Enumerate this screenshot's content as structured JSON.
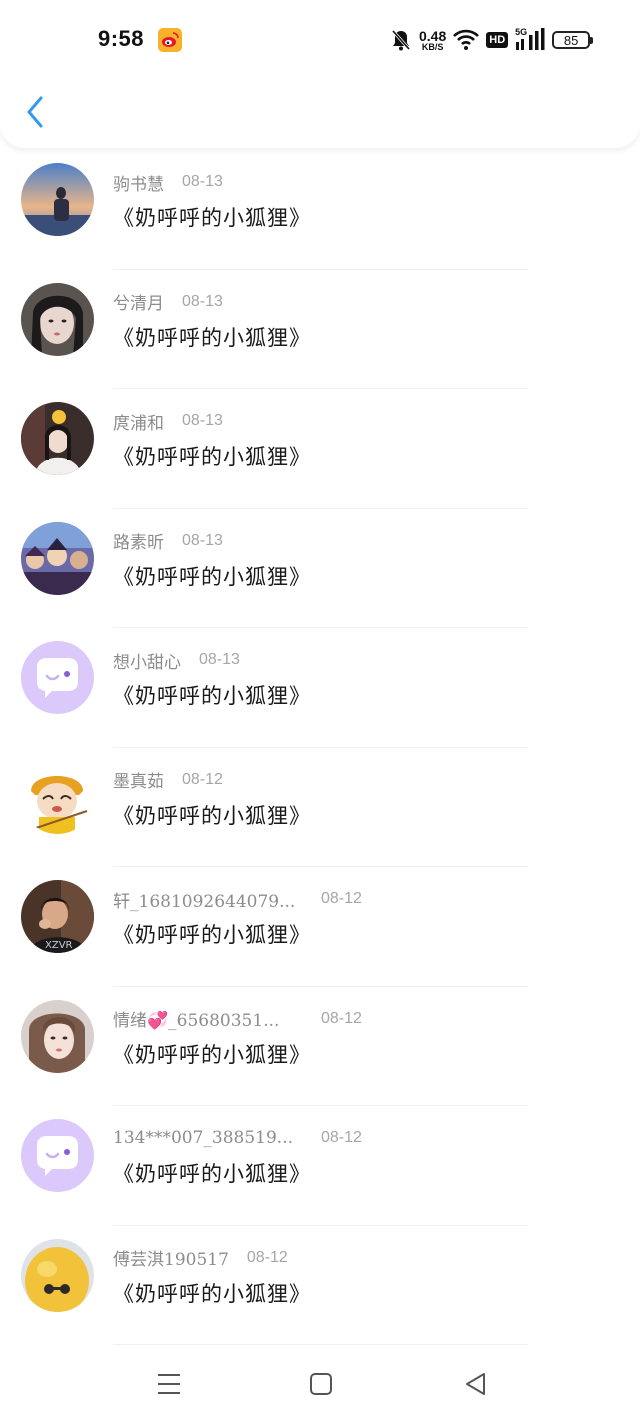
{
  "status_bar": {
    "time": "9:58",
    "net_speed": "0.48",
    "net_unit": "KB/S",
    "hd_label": "HD",
    "signal_label": "5G",
    "battery": "85"
  },
  "header": {
    "back_icon": "chevron-left-icon",
    "accent_color": "#2f9bea"
  },
  "list": [
    {
      "name": "驹书慧",
      "date": "08-13",
      "message": "《奶呼呼的小狐狸》",
      "avatar": "photo"
    },
    {
      "name": "兮清月",
      "date": "08-13",
      "message": "《奶呼呼的小狐狸》",
      "avatar": "photo"
    },
    {
      "name": "庹浦和",
      "date": "08-13",
      "message": "《奶呼呼的小狐狸》",
      "avatar": "photo"
    },
    {
      "name": "路素昕",
      "date": "08-13",
      "message": "《奶呼呼的小狐狸》",
      "avatar": "photo"
    },
    {
      "name": "想小甜心",
      "date": "08-13",
      "message": "《奶呼呼的小狐狸》",
      "avatar": "default-chat-icon"
    },
    {
      "name": "墨真茹",
      "date": "08-12",
      "message": "《奶呼呼的小狐狸》",
      "avatar": "cartoon"
    },
    {
      "name": "轩_1681092644079...",
      "date": "08-12",
      "message": "《奶呼呼的小狐狸》",
      "avatar": "photo"
    },
    {
      "name": "情绪💞_65680351...",
      "date": "08-12",
      "message": "《奶呼呼的小狐狸》",
      "avatar": "photo"
    },
    {
      "name": "134***007_388519...",
      "date": "08-12",
      "message": "《奶呼呼的小狐狸》",
      "avatar": "default-chat-icon"
    },
    {
      "name": "傅芸淇190517",
      "date": "08-12",
      "message": "《奶呼呼的小狐狸》",
      "avatar": "photo"
    }
  ],
  "nav_bar": {
    "menu_icon": "menu-icon",
    "home_icon": "home-square-icon",
    "back_icon": "back-triangle-icon"
  }
}
